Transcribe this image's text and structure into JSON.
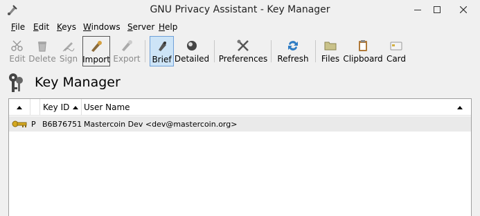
{
  "window": {
    "title": "GNU Privacy Assistant - Key Manager"
  },
  "menu": [
    {
      "label": "File",
      "mnemonic": "F",
      "rest": "ile"
    },
    {
      "label": "Edit",
      "mnemonic": "E",
      "rest": "dit"
    },
    {
      "label": "Keys",
      "mnemonic": "K",
      "rest": "eys"
    },
    {
      "label": "Windows",
      "mnemonic": "W",
      "rest": "indows"
    },
    {
      "label": "Server",
      "mnemonic": "S",
      "rest": "erver"
    },
    {
      "label": "Help",
      "mnemonic": "H",
      "rest": "elp"
    }
  ],
  "toolbar": {
    "edit": "Edit",
    "delete": "Delete",
    "sign": "Sign",
    "import": "Import",
    "export": "Export",
    "brief": "Brief",
    "detailed": "Detailed",
    "preferences": "Preferences",
    "refresh": "Refresh",
    "files": "Files",
    "clipboard": "Clipboard",
    "card": "Card"
  },
  "heading": "Key Manager",
  "table": {
    "columns": {
      "keyid": "Key ID",
      "username": "User Name"
    },
    "rows": [
      {
        "type": "P",
        "keyid": "B6B76751",
        "username": "Mastercoin Dev <dev@mastercoin.org>"
      }
    ]
  },
  "colors": {
    "active_button": "#cde4f7",
    "selected_row": "#eaeaea"
  }
}
